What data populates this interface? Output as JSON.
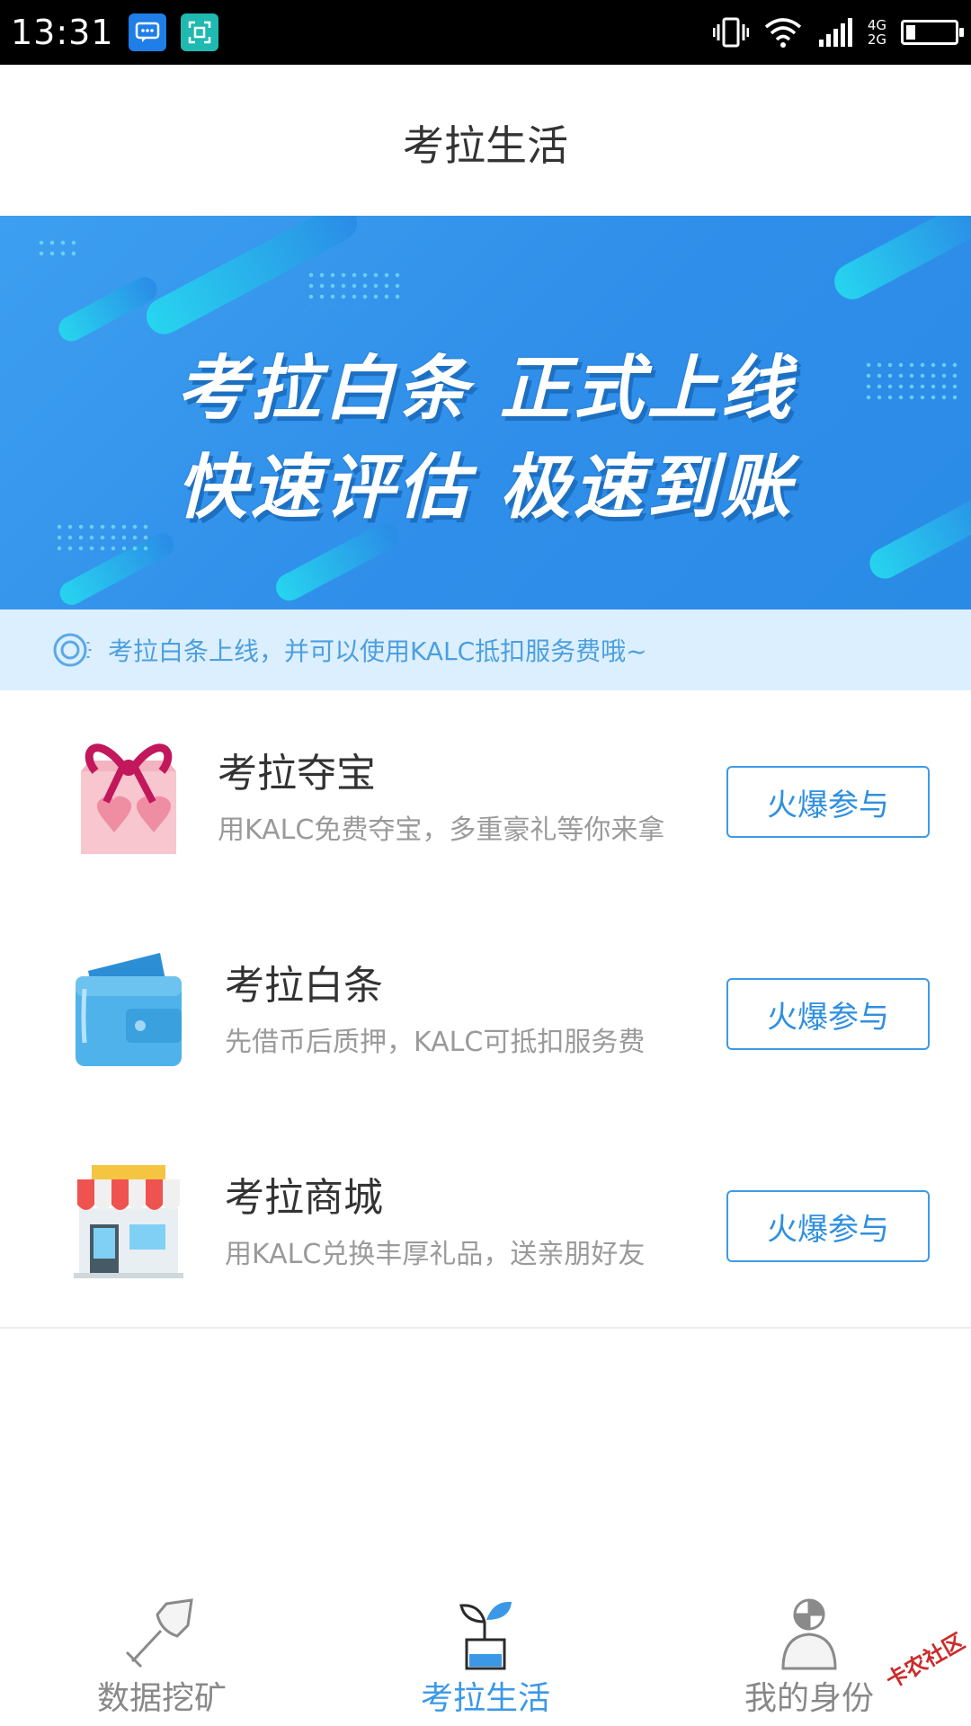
{
  "status_bar": {
    "time": "13:31",
    "network_top": "4G",
    "network_bottom": "2G",
    "battery_level": 0.2,
    "icons": [
      "message-app-icon",
      "scanner-app-icon",
      "vibrate-icon",
      "wifi-icon",
      "signal-icon",
      "battery-icon"
    ]
  },
  "header": {
    "title": "考拉生活"
  },
  "banner": {
    "line1": "考拉白条  正式上线",
    "line2": "快速评估  极速到账"
  },
  "notice": {
    "text": "考拉白条上线，并可以使用KALC抵扣服务费哦~",
    "icon": "speaker-icon"
  },
  "items": [
    {
      "title": "考拉夺宝",
      "subtitle": "用KALC免费夺宝，多重豪礼等你来拿",
      "button": "火爆参与",
      "icon": "gift-box-icon"
    },
    {
      "title": "考拉白条",
      "subtitle": "先借币后质押，KALC可抵扣服务费",
      "button": "火爆参与",
      "icon": "wallet-icon"
    },
    {
      "title": "考拉商城",
      "subtitle": "用KALC兑换丰厚礼品，送亲朋好友",
      "button": "火爆参与",
      "icon": "shop-icon"
    }
  ],
  "tabs": [
    {
      "label": "数据挖矿",
      "icon": "shovel-icon",
      "active": false
    },
    {
      "label": "考拉生活",
      "icon": "sprout-icon",
      "active": true
    },
    {
      "label": "我的身份",
      "icon": "user-icon",
      "active": false
    }
  ],
  "watermark": "卡农社区",
  "colors": {
    "accent": "#3b98e6",
    "banner": "#2f8ee9",
    "notice_bg": "#dcefff"
  }
}
